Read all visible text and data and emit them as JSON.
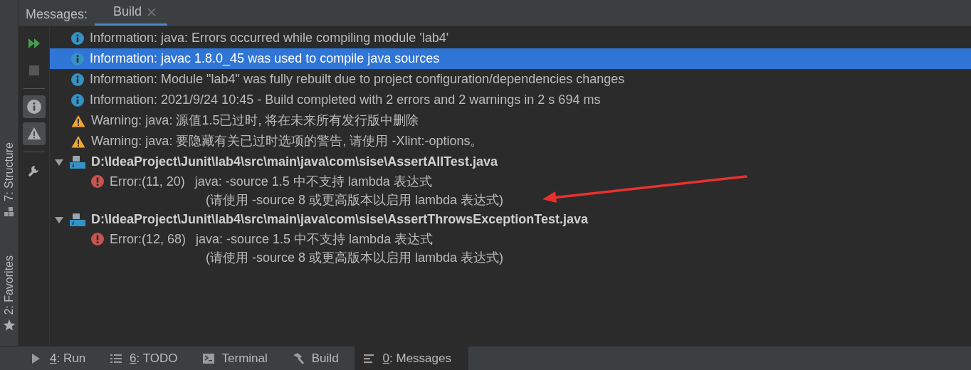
{
  "header": {
    "label": "Messages:",
    "tabs": [
      {
        "label": "Build",
        "selected": true
      }
    ]
  },
  "left_stripe": [
    {
      "label": "7: Structure",
      "kind": "structure"
    },
    {
      "label": "2: Favorites",
      "kind": "favorites"
    }
  ],
  "toolbar": [
    {
      "kind": "rerun",
      "disabled": false
    },
    {
      "kind": "stop",
      "disabled": true
    },
    {
      "kind": "separator"
    },
    {
      "kind": "info",
      "selected": true
    },
    {
      "kind": "warning",
      "selected": true
    },
    {
      "kind": "separator"
    },
    {
      "kind": "settings"
    }
  ],
  "messages": [
    {
      "kind": "info",
      "text": "Information: java: Errors occurred while compiling module 'lab4'",
      "selected": false
    },
    {
      "kind": "info",
      "text": "Information: javac 1.8.0_45 was used to compile java sources",
      "selected": true
    },
    {
      "kind": "info",
      "text": "Information: Module \"lab4\" was fully rebuilt due to project configuration/dependencies changes",
      "selected": false
    },
    {
      "kind": "info",
      "text": "Information: 2021/9/24 10:45 - Build completed with 2 errors and 2 warnings in 2 s 694 ms",
      "selected": false
    },
    {
      "kind": "warning",
      "text": "Warning: java: 源值1.5已过时, 将在未来所有发行版中删除",
      "selected": false
    },
    {
      "kind": "warning",
      "text": "Warning: java: 要隐藏有关已过时选项的警告, 请使用 -Xlint:-options。",
      "selected": false
    },
    {
      "kind": "file",
      "text": "D:\\IdeaProject\\Junit\\lab4\\src\\main\\java\\com\\sise\\AssertAllTest.java",
      "selected": false,
      "expanded": true,
      "children": [
        {
          "kind": "error",
          "location": "Error:(11, 20)",
          "lines": [
            "java: -source 1.5 中不支持 lambda 表达式",
            "(请使用 -source 8 或更高版本以启用 lambda 表达式)"
          ],
          "selected": false
        }
      ]
    },
    {
      "kind": "file",
      "text": "D:\\IdeaProject\\Junit\\lab4\\src\\main\\java\\com\\sise\\AssertThrowsExceptionTest.java",
      "selected": false,
      "expanded": true,
      "children": [
        {
          "kind": "error",
          "location": "Error:(12, 68)",
          "lines": [
            "java: -source 1.5 中不支持 lambda 表达式",
            "(请使用 -source 8 或更高版本以启用 lambda 表达式)"
          ],
          "selected": false
        }
      ]
    }
  ],
  "annotations": [
    {
      "kind": "arrow"
    }
  ],
  "bottom_bar": [
    {
      "kind": "run",
      "label": "4: Run",
      "mnemonic": true,
      "selected": false
    },
    {
      "kind": "todo",
      "label": "6: TODO",
      "mnemonic": true,
      "selected": false
    },
    {
      "kind": "terminal",
      "label": "Terminal",
      "mnemonic": false,
      "selected": false
    },
    {
      "kind": "build",
      "label": "Build",
      "mnemonic": false,
      "selected": false
    },
    {
      "kind": "messages",
      "label": "0: Messages",
      "mnemonic": true,
      "selected": true
    }
  ]
}
